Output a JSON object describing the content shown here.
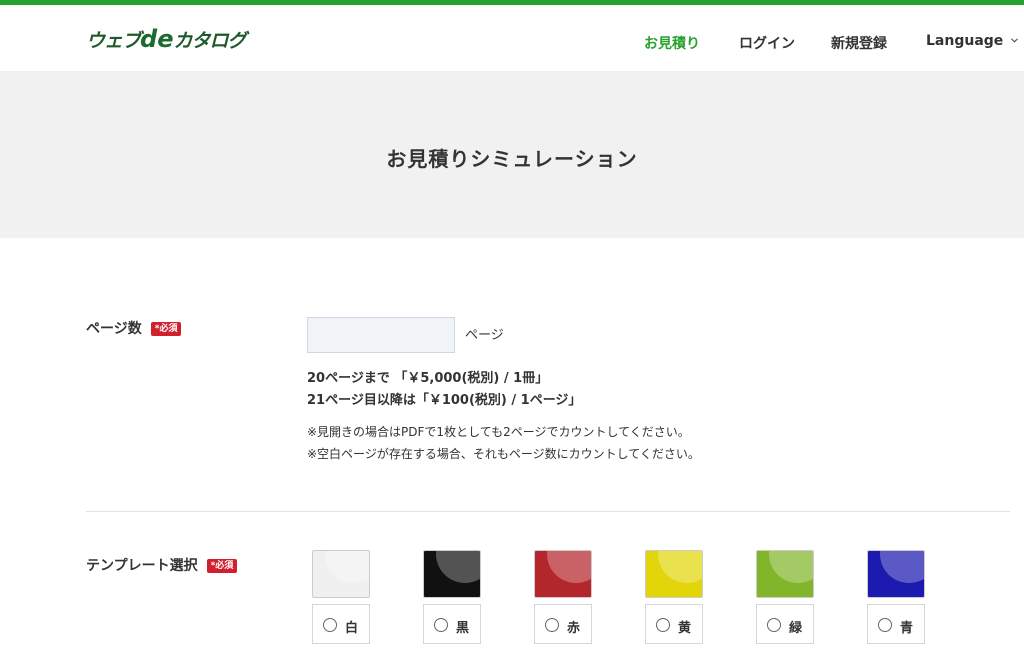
{
  "header": {
    "logo_prefix": "ウェブ",
    "logo_de": "de",
    "logo_suffix": "カタログ",
    "nav": {
      "quote": "お見積り",
      "login": "ログイン",
      "register": "新規登録",
      "language": "Language"
    }
  },
  "hero": {
    "title": "お見積りシミュレーション"
  },
  "form": {
    "pages": {
      "label": "ページ数",
      "required": "*必須",
      "value": "",
      "unit": "ページ",
      "price1": "20ページまで 「￥5,000(税別) / 1冊」",
      "price2": "21ページ目以降は「￥100(税別) / 1ページ」",
      "note1": "※見開きの場合はPDFで1枚としても2ページでカウントしてください。",
      "note2": "※空白ページが存在する場合、それもページ数にカウントしてください。"
    },
    "template": {
      "label": "テンプレート選択",
      "required": "*必須",
      "options": [
        {
          "label": "白",
          "color": "#f0f0f0"
        },
        {
          "label": "黒",
          "color": "#111111"
        },
        {
          "label": "赤",
          "color": "#b3262c"
        },
        {
          "label": "黄",
          "color": "#e2d60a"
        },
        {
          "label": "緑",
          "color": "#82b62a"
        },
        {
          "label": "青",
          "color": "#1d1ab0"
        }
      ]
    }
  },
  "colors": {
    "accent": "#27a22f",
    "required_badge": "#d0202d"
  }
}
